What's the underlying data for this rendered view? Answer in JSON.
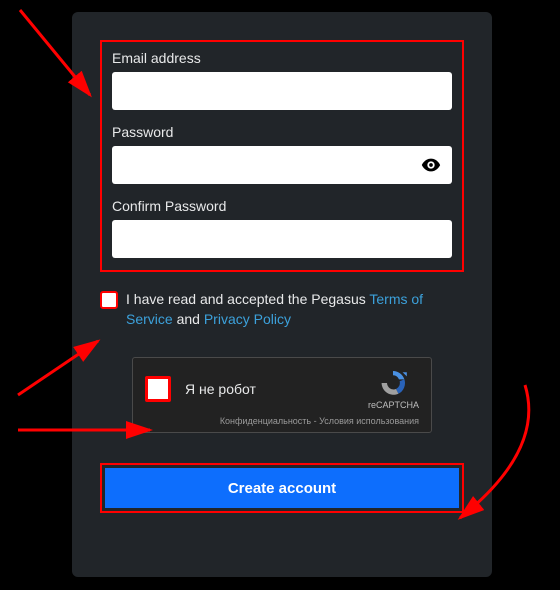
{
  "form": {
    "email_label": "Email address",
    "password_label": "Password",
    "confirm_label": "Confirm Password"
  },
  "terms": {
    "prefix": "I have read and accepted the Pegasus ",
    "tos": "Terms of Service",
    "middle": " and ",
    "privacy": "Privacy Policy"
  },
  "captcha": {
    "label": "Я не робот",
    "brand": "reCAPTCHA",
    "footer": "Конфиденциальность - Условия использования"
  },
  "submit_label": "Create account"
}
